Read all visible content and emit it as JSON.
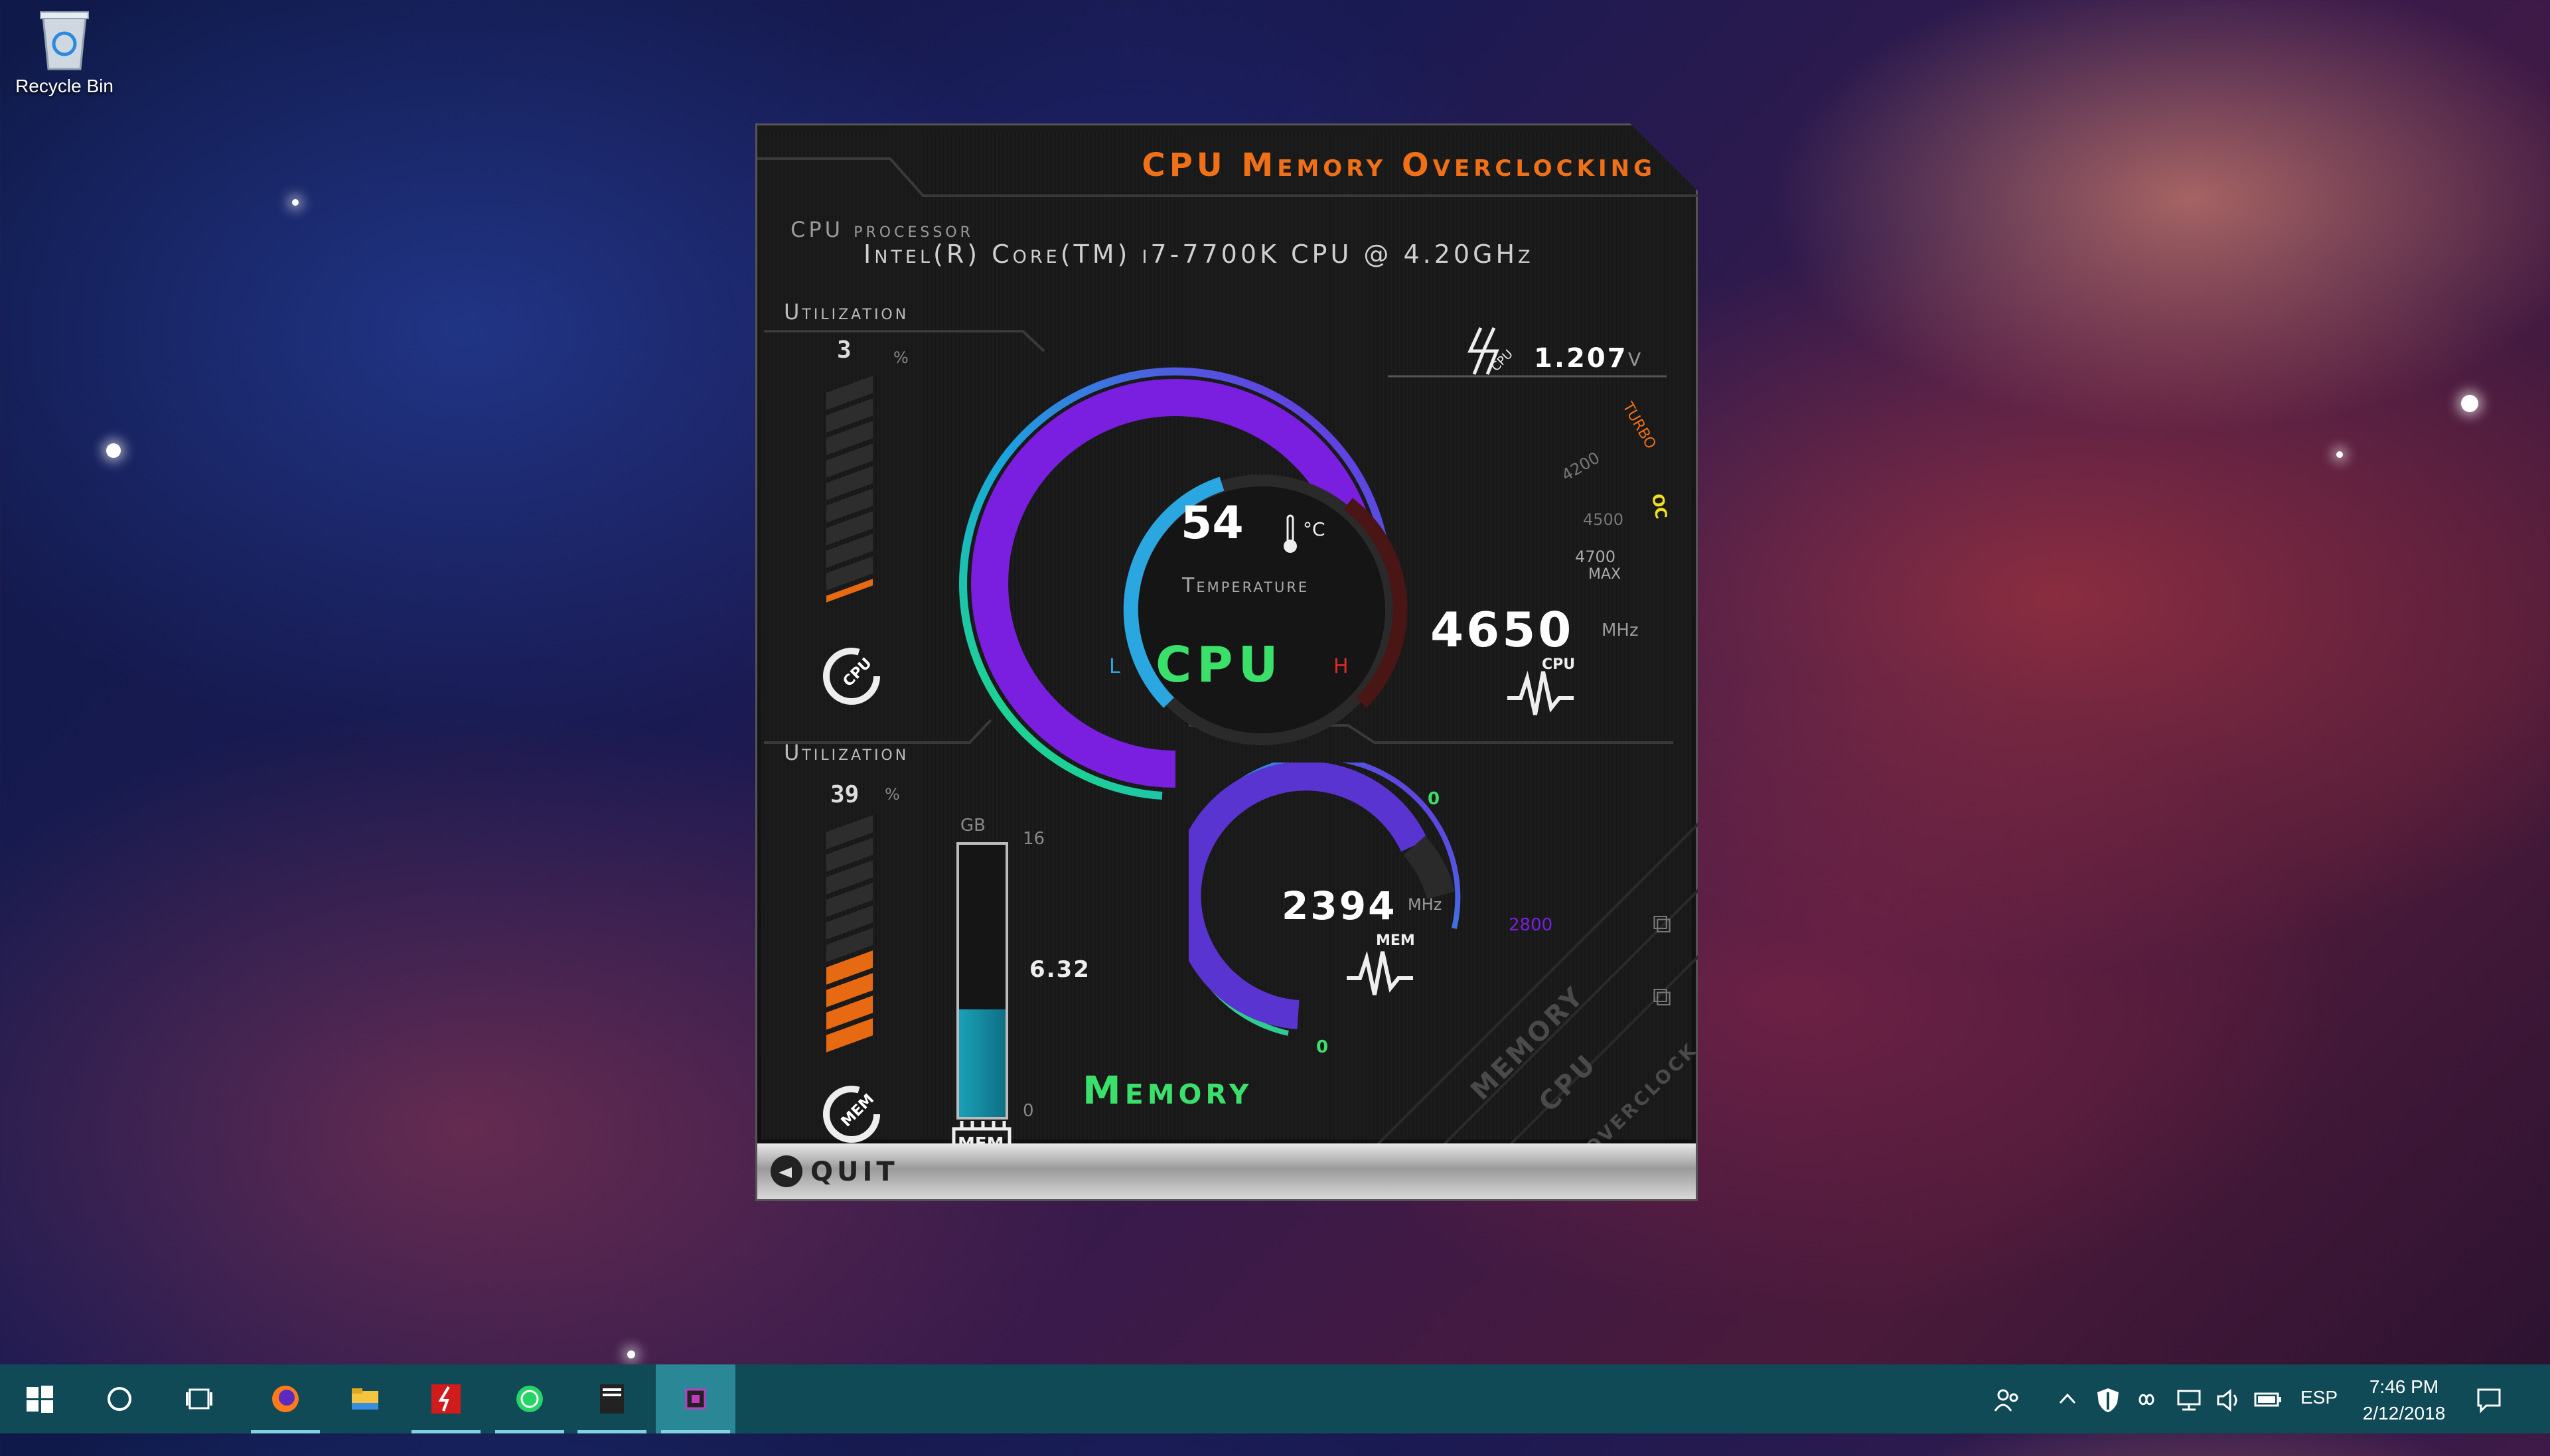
{
  "desktop": {
    "recycle_bin_label": "Recycle Bin"
  },
  "app": {
    "title": "CPU Memory Overclocking",
    "processor_label": "CPU processor",
    "processor_name": "Intel(R) Core(TM) i7-7700K CPU @ 4.20GHz",
    "cpu": {
      "utilization_label": "Utilization",
      "utilization_value": "3",
      "utilization_unit": "%",
      "utilization_fraction": 0.03,
      "temperature_value": "54",
      "temperature_unit": "°C",
      "temperature_label": "Temperature",
      "gauge_low": "L",
      "gauge_high": "H",
      "section_label": "CPU",
      "voltage_value": "1.207",
      "voltage_unit": "V",
      "voltage_icon_label": "CPU",
      "frequency_value": "4650",
      "frequency_unit": "MHz",
      "frequency_icon_label": "CPU",
      "gauge_zero": "0",
      "gauge_marks": {
        "turbo_value": "4200",
        "turbo_label": "TURBO",
        "oc_value": "4500",
        "oc_label": "OC",
        "max_value": "4700",
        "max_label": "MAX"
      },
      "util_icon_label": "CPU"
    },
    "memory": {
      "utilization_label": "Utilization",
      "utilization_value": "39",
      "utilization_unit": "%",
      "utilization_fraction": 0.39,
      "gb_label": "GB",
      "gb_max": "16",
      "gb_min": "0",
      "gb_used": "6.32",
      "gb_fraction": 0.395,
      "frequency_value": "2394",
      "frequency_unit": "MHz",
      "frequency_max": "2800",
      "gauge_zero": "0",
      "frequency_icon_label": "MEM",
      "section_label": "Memory",
      "util_icon_label": "MEM",
      "chip_label": "MEM"
    },
    "side_tabs": [
      "MEMORY",
      "CPU",
      "OVERCLOCK"
    ],
    "quit_label": "QUIT"
  },
  "taskbar": {
    "language": "ESP",
    "time": "7:46 PM",
    "date": "2/12/2018"
  },
  "colors": {
    "accent_orange": "#f07018",
    "gauge_purple": "#7a1fe0",
    "gauge_green": "#3ae06a",
    "gauge_blue": "#2aa6e0",
    "taskbar": "#0f4a56"
  }
}
